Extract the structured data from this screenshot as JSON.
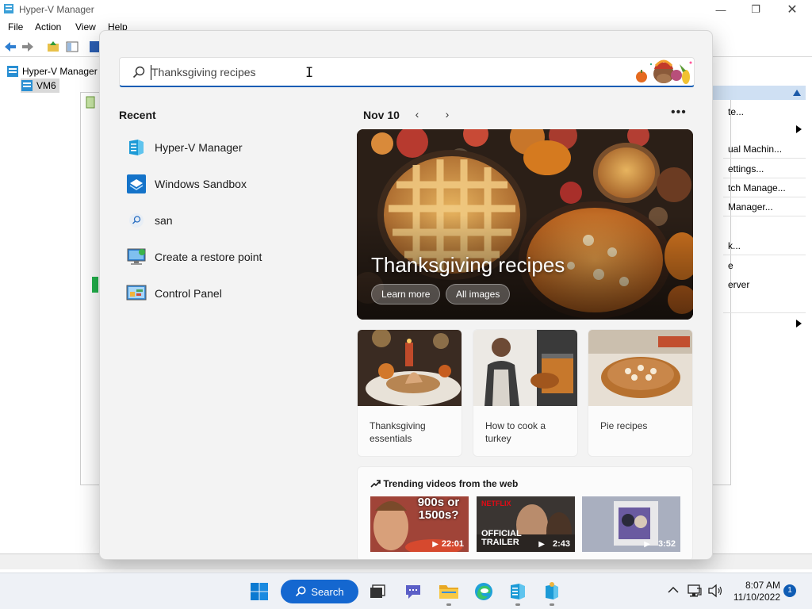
{
  "hyperv": {
    "title": "Hyper-V Manager",
    "menu": [
      "File",
      "Action",
      "View",
      "Help"
    ],
    "tree": {
      "root": "Hyper-V Manager",
      "child": "VM6"
    },
    "actions": [
      "te...",
      "",
      "ual Machin...",
      "ettings...",
      "tch Manage...",
      "Manager...",
      "k...",
      "e",
      "erver"
    ]
  },
  "search": {
    "query": "Thanksgiving recipes"
  },
  "recent": {
    "title": "Recent",
    "items": [
      {
        "label": "Hyper-V Manager",
        "icon": "hyperv-icon"
      },
      {
        "label": "Windows Sandbox",
        "icon": "sandbox-icon"
      },
      {
        "label": "san",
        "icon": "search-icon"
      },
      {
        "label": "Create a restore point",
        "icon": "restore-point-icon"
      },
      {
        "label": "Control Panel",
        "icon": "control-panel-icon"
      }
    ]
  },
  "highlights": {
    "date": "Nov 10",
    "hero": {
      "title": "Thanksgiving recipes",
      "learn_more": "Learn more",
      "all_images": "All images"
    },
    "cards": [
      {
        "caption": "Thanksgiving essentials"
      },
      {
        "caption": "How to cook a turkey"
      },
      {
        "caption": "Pie recipes"
      }
    ],
    "trending": {
      "title": "Trending videos from the web",
      "videos": [
        {
          "duration": "22:01",
          "overlay": "900s or 1500s?"
        },
        {
          "duration": "2:43",
          "overlay": "OFFICIAL TRAILER",
          "brand": "NETFLIX"
        },
        {
          "duration": "3:52",
          "overlay": ""
        }
      ]
    }
  },
  "taskbar": {
    "search_label": "Search",
    "time": "8:07 AM",
    "date": "11/10/2022",
    "notifications": "1"
  },
  "colors": {
    "accent": "#0f5cb4",
    "search_button": "#1467d0"
  }
}
